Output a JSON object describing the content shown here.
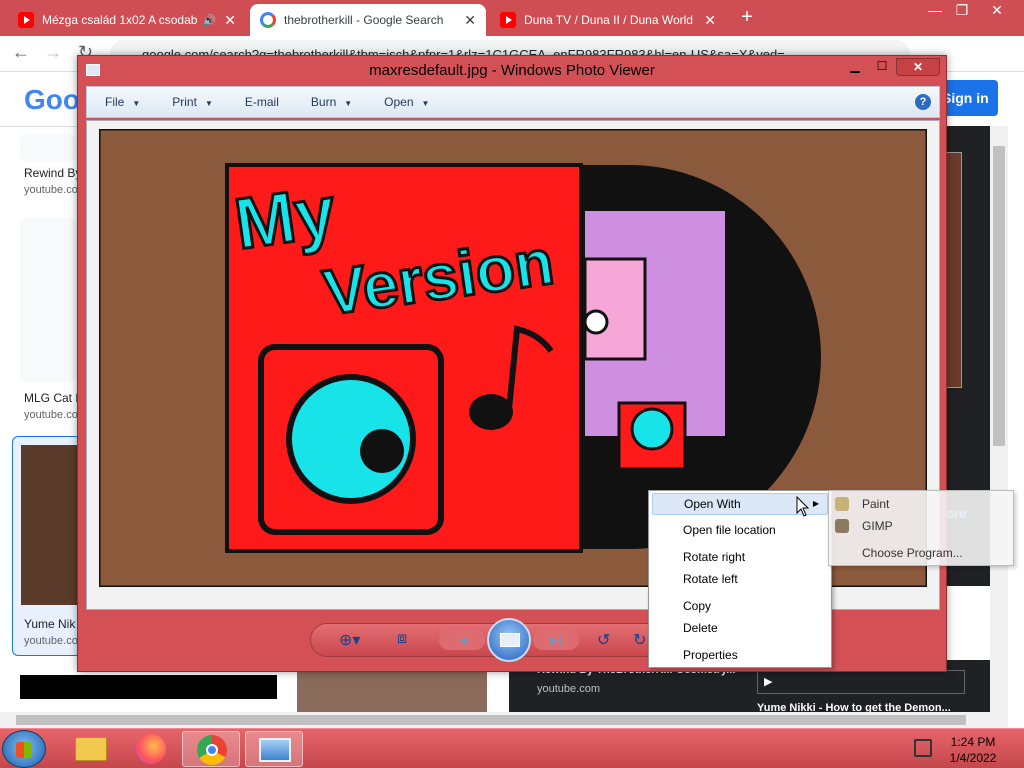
{
  "browser": {
    "tabs": [
      {
        "title": "Mézga család 1x02 A csodab",
        "favicon": "youtube-icon",
        "active": false
      },
      {
        "title": "thebrotherkill - Google Search",
        "favicon": "google-icon",
        "active": true
      },
      {
        "title": "Duna TV / Duna II / Duna World",
        "favicon": "youtube-icon",
        "active": false
      }
    ],
    "new_tab": "+",
    "url": "google.com/search?q=thebrotherkill&tbm=isch&pfpr=1&rlz=1C1GCEA_enFR983FR983&hl=en-US&sa=X&ved=",
    "accent": "#ce4e54"
  },
  "google": {
    "logo": "Goo",
    "sign_in": "Sign in",
    "results": [
      {
        "title": "Rewind By",
        "source": "youtube.co"
      },
      {
        "title": "MLG Cat D",
        "source": "youtube.co"
      },
      {
        "title": "Yume Nik",
        "source": "youtube.co"
      }
    ],
    "right_more": "ore",
    "bottom_result": {
      "title": "Rewind By TheBrotherKill Geometry...",
      "source": "youtube.com"
    },
    "bottom_next": "Yume Nikki - How to get the Demon..."
  },
  "viewer": {
    "title": "maxresdefault.jpg - Windows Photo Viewer",
    "menu": [
      {
        "label": "File",
        "caret": true
      },
      {
        "label": "Print",
        "caret": true
      },
      {
        "label": "E-mail",
        "caret": false
      },
      {
        "label": "Burn",
        "caret": true
      },
      {
        "label": "Open",
        "caret": true
      }
    ],
    "help": "?",
    "image_text": {
      "line1": "My",
      "line2": "Version"
    },
    "colors": {
      "frame": "#d35055",
      "image_bg": "#8b5a3c",
      "cover_red": "#ff1a1a",
      "cyan": "#17e3e8"
    }
  },
  "context_menu": {
    "items": [
      "Open With",
      "Open file location",
      "Rotate right",
      "Rotate left",
      "Copy",
      "Delete",
      "Properties"
    ],
    "highlighted": "Open With",
    "submenu": [
      "Paint",
      "GIMP",
      "Choose Program..."
    ]
  },
  "taskbar": {
    "apps": [
      "folder-icon",
      "firefox-icon",
      "chrome-icon",
      "photo-viewer-icon"
    ],
    "time": "1:24 PM",
    "date": "1/4/2022"
  }
}
